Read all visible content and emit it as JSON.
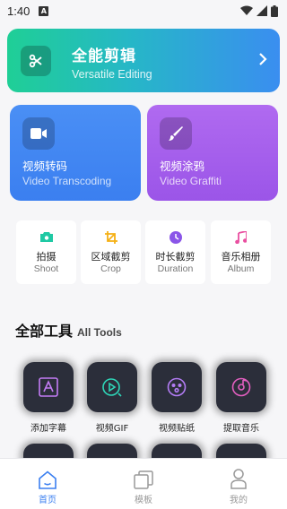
{
  "status": {
    "time": "1:40",
    "notif": "A"
  },
  "hero": {
    "title": "全能剪辑",
    "subtitle": "Versatile Editing",
    "icon": "scissors-icon"
  },
  "feature_cards": [
    {
      "title": "视频转码",
      "subtitle": "Video Transcoding",
      "color": "#3b7ff0",
      "icon": "video-camera-icon"
    },
    {
      "title": "视频涂鸦",
      "subtitle": "Video Graffiti",
      "color": "#9b55e8",
      "icon": "brush-icon"
    }
  ],
  "quick_tools": [
    {
      "zh": "拍摄",
      "en": "Shoot",
      "icon": "camera-icon",
      "color": "#1fc9a4"
    },
    {
      "zh": "区域截剪",
      "en": "Crop",
      "icon": "crop-icon",
      "color": "#f5b014"
    },
    {
      "zh": "时长截剪",
      "en": "Duration",
      "icon": "clock-icon",
      "color": "#8a55e8"
    },
    {
      "zh": "音乐相册",
      "en": "Album",
      "icon": "music-note-icon",
      "color": "#e94fa0"
    }
  ],
  "all_tools": {
    "title_zh": "全部工具",
    "title_en": "All Tools"
  },
  "tools": [
    {
      "label": "添加字幕",
      "icon": "subtitle-icon"
    },
    {
      "label": "视频GIF",
      "icon": "gif-play-icon"
    },
    {
      "label": "视频贴纸",
      "icon": "sticker-face-icon"
    },
    {
      "label": "提取音乐",
      "icon": "music-disc-icon"
    }
  ],
  "tabbar": [
    {
      "label": "首页",
      "icon": "home-icon",
      "active": true
    },
    {
      "label": "模板",
      "icon": "template-icon",
      "active": false
    },
    {
      "label": "我的",
      "icon": "user-icon",
      "active": false
    }
  ],
  "accent": "#3b7ff0"
}
